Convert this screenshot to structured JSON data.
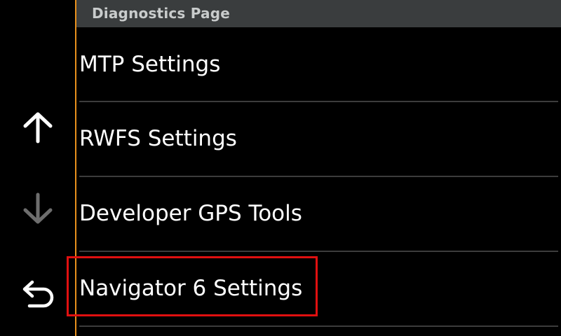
{
  "header": {
    "title": "Diagnostics Page"
  },
  "menu": {
    "items": [
      {
        "label": "MTP Settings"
      },
      {
        "label": "RWFS Settings"
      },
      {
        "label": "Developer GPS Tools"
      },
      {
        "label": "Navigator 6 Settings"
      }
    ]
  },
  "nav": {
    "up_icon": "arrow-up-icon",
    "down_icon": "arrow-down-icon",
    "back_icon": "back-icon"
  },
  "colors": {
    "background": "#000000",
    "header_bg": "#3a3d3e",
    "header_text": "#c9cccc",
    "accent_orange": "#e8901c",
    "highlight_red": "#e01010",
    "separator": "#3c3c3c",
    "disabled_arrow": "#6e6e6e"
  }
}
